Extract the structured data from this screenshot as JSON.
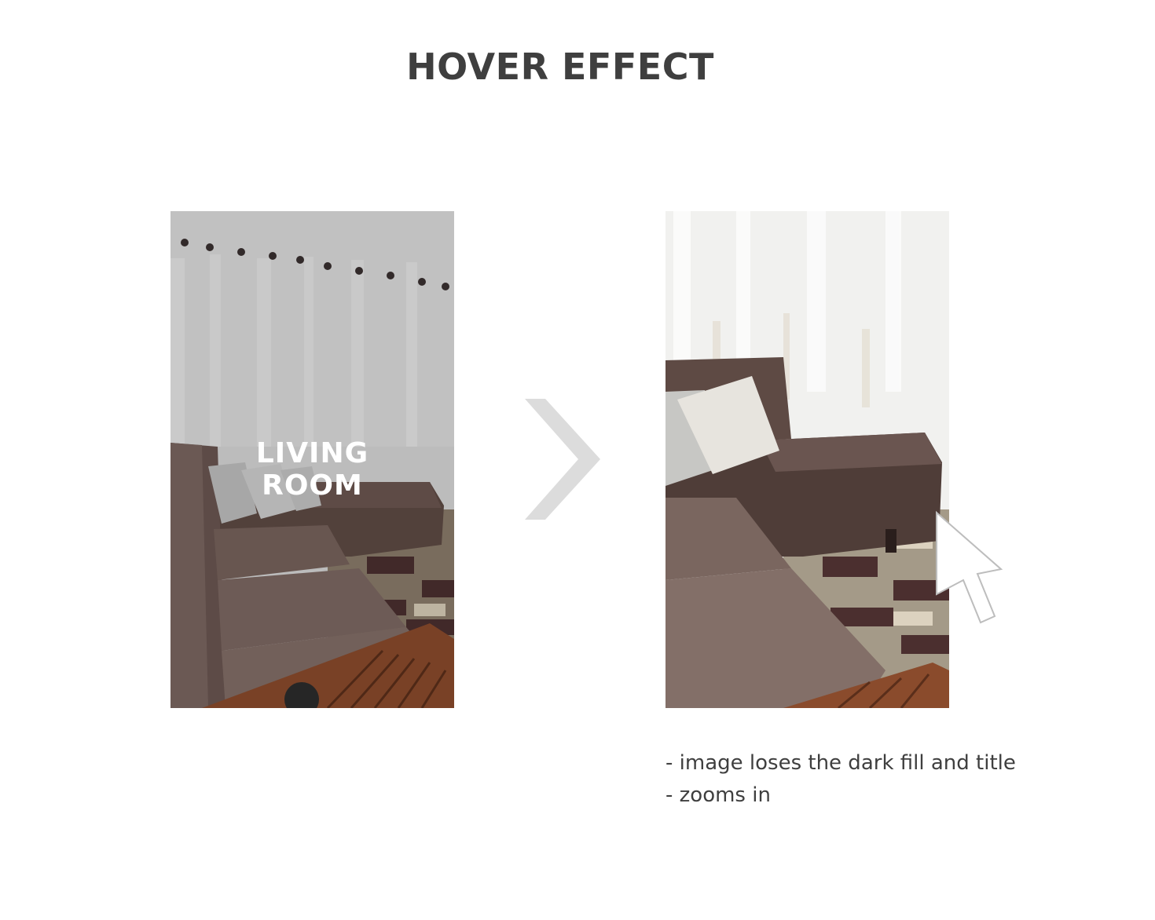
{
  "heading": "HOVER EFFECT",
  "before_panel": {
    "title_line_1": "LIVING",
    "title_line_2": "ROOM"
  },
  "notes": [
    "- image loses the dark fill and title",
    "- zooms in"
  ],
  "colors": {
    "heading": "#3f3f3f",
    "chevron": "#dcdcdc",
    "sofa": "#6e5a52",
    "overlay_title": "#ffffff"
  },
  "icons": {
    "chevron": "chevron-right-icon",
    "cursor": "mouse-pointer-icon"
  }
}
